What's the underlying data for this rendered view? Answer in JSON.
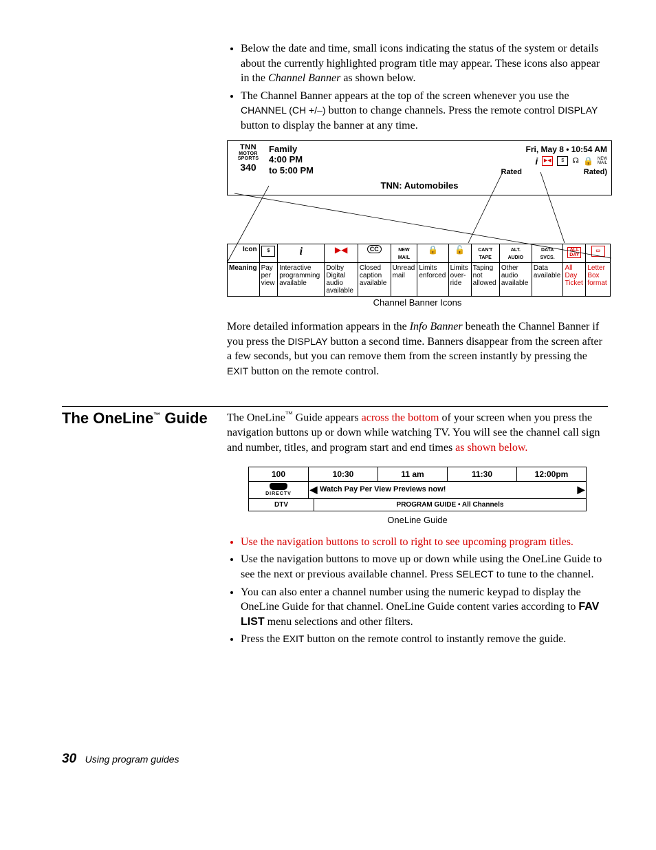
{
  "intro": {
    "b1a": "Below the date and time, small icons indicating the status of the system or details about the currently highlighted program title may appear. These icons also appear in the ",
    "b1_em": "Channel Banner",
    "b1b": " as shown below.",
    "b2a": "The Channel Banner appears at the top of the screen whenever you use the ",
    "b2_btn1": "CHANNEL (CH +/–)",
    "b2b": " button to change channels. Press the remote control ",
    "b2_btn2": "DISPLAY",
    "b2c": " button to display the banner at any time."
  },
  "banner": {
    "logo_top": "TNN",
    "logo_mid": "MOTOR SPORTS",
    "logo_num": "340",
    "prog_name": "Family",
    "prog_start": "4:00 PM",
    "prog_end": "to 5:00 PM",
    "date": "Fri, May 8  •  10:54 AM",
    "rated_left": "Rated",
    "rated_right": "Rated)",
    "center_title": "TNN: Automobiles",
    "fig_caption": "Channel Banner Icons"
  },
  "icon_table": {
    "row_icon_hdr": "Icon",
    "row_mean_hdr": "Meaning",
    "cols": [
      {
        "icon": "$",
        "mean": "Pay per view",
        "red": false,
        "box": true
      },
      {
        "icon": "i",
        "mean": "Interactive programming available",
        "red": false,
        "box": false,
        "italic": true
      },
      {
        "icon": "▶◀",
        "mean": "Dolby Digital audio available",
        "red": true,
        "box": false
      },
      {
        "icon": "CC",
        "mean": "Closed caption available",
        "red": false,
        "box": false,
        "oval": true
      },
      {
        "icon": "NEW MAIL",
        "mean": "Unread mail",
        "red": false,
        "box": false,
        "stack": true
      },
      {
        "icon": "🔒",
        "mean": "Limits enforced",
        "red": false,
        "box": false
      },
      {
        "icon": "🔓",
        "mean": "Limits over-ride",
        "red": false,
        "box": false
      },
      {
        "icon": "CAN'T TAPE",
        "mean": "Taping not allowed",
        "red": false,
        "box": false,
        "stack": true
      },
      {
        "icon": "ALT. AUDIO",
        "mean": "Other audio available",
        "red": false,
        "box": false,
        "stack": true
      },
      {
        "icon": "DATA SVCS.",
        "mean": "Data available",
        "red": false,
        "box": false,
        "stack": true
      },
      {
        "icon": "ALL DAY",
        "mean": "All Day Ticket",
        "red": true,
        "box": true,
        "meanred": true
      },
      {
        "icon": "▭",
        "mean": "Letter Box format",
        "red": true,
        "box": true,
        "meanred": true
      }
    ]
  },
  "post_banner": {
    "p1a": "More detailed information appears in the ",
    "p1_em": "Info Banner",
    "p1b": " beneath the Channel Banner if you press the ",
    "p1_btn": "DISPLAY",
    "p1c": " button a second time. Banners disappear from the screen after a few seconds, but you can remove them from the screen instantly by pressing the ",
    "p1_btn2": "EXIT",
    "p1d": " button on the remote control."
  },
  "oneline": {
    "heading": "The OneLine™ Guide",
    "p1a": "The OneLine",
    "p1_tm": "™",
    "p1b": " Guide appears ",
    "p1_red": "across the bottom",
    "p1c": " of your screen when you press the navigation buttons up or down while watching TV. You will see the channel call sign and number, titles, and program start and end times ",
    "p1_red2": "as shown below.",
    "grid": {
      "ch": "100",
      "t1": "10:30",
      "t2": "11 am",
      "t3": "11:30",
      "t4": "12:00pm",
      "logo": "DIRECTV",
      "row2": "Watch Pay Per View Previews now!",
      "row3a": "DTV",
      "row3b": "PROGRAM GUIDE  •  All Channels"
    },
    "fig_caption": "OneLine Guide",
    "b1": "Use the navigation buttons to scroll to right to see upcoming program titles.",
    "b2a": "Use the navigation buttons to move up or down while using the OneLine Guide to see the next or previous available channel. Press ",
    "b2_btn": "SELECT",
    "b2b": " to tune to the channel.",
    "b3a": "You can also enter a channel number using the numeric keypad to display the OneLine Guide for that channel. OneLine Guide content varies according to ",
    "b3_bold": "FAV LIST",
    "b3b": " menu selections and other filters.",
    "b4a": "Press the ",
    "b4_btn": "EXIT",
    "b4b": " button on the remote control to instantly remove the guide."
  },
  "footer": {
    "page": "30",
    "label": "Using program guides"
  }
}
